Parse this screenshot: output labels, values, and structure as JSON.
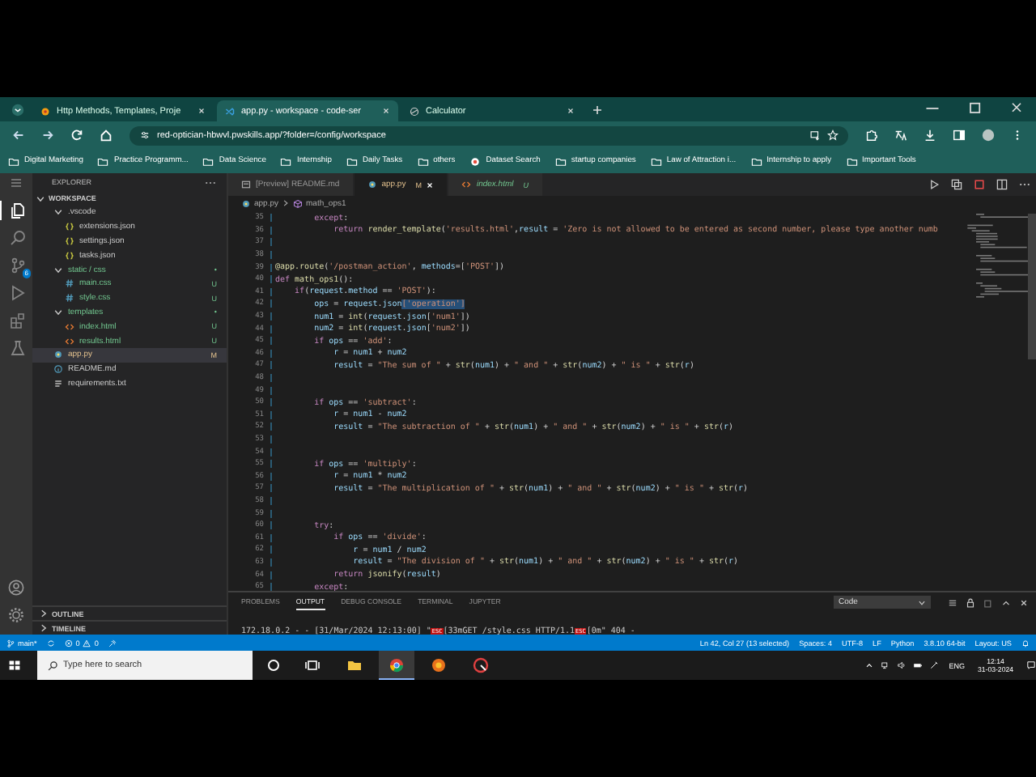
{
  "browser": {
    "tabs": [
      {
        "title": "Http Methods, Templates, Proje",
        "kind": "site",
        "selected": false
      },
      {
        "title": "app.py - workspace - code-ser",
        "kind": "code",
        "selected": true
      },
      {
        "title": "Calculator",
        "kind": "globe",
        "selected": false
      }
    ],
    "url": "red-optician-hbwvl.pwskills.app/?folder=/config/workspace",
    "bookmarks": [
      {
        "label": "Digital Marketing",
        "kind": "folder"
      },
      {
        "label": "Practice Programm...",
        "kind": "folder"
      },
      {
        "label": "Data Science",
        "kind": "folder"
      },
      {
        "label": "Internship",
        "kind": "folder"
      },
      {
        "label": "Daily Tasks",
        "kind": "folder"
      },
      {
        "label": "others",
        "kind": "folder"
      },
      {
        "label": "Dataset Search",
        "kind": "site"
      },
      {
        "label": "startup companies",
        "kind": "folder"
      },
      {
        "label": "Law of Attraction i...",
        "kind": "folder"
      },
      {
        "label": "Internship to apply",
        "kind": "folder"
      },
      {
        "label": "Important Tools",
        "kind": "folder"
      }
    ]
  },
  "activity_bar": {
    "items": [
      {
        "kind": "files",
        "selected": true
      },
      {
        "kind": "search",
        "selected": false
      },
      {
        "kind": "source-control",
        "selected": false,
        "badge": "6"
      },
      {
        "kind": "run",
        "selected": false
      },
      {
        "kind": "extensions",
        "selected": false
      },
      {
        "kind": "testing",
        "selected": false
      }
    ]
  },
  "sidebar": {
    "title": "EXPLORER",
    "section": "WORKSPACE",
    "items": [
      {
        "name": ".vscode",
        "kind": "folder",
        "expanded": true,
        "selected": false,
        "children": [
          {
            "name": "extensions.json",
            "kind": "json",
            "selected": false
          },
          {
            "name": "settings.json",
            "kind": "json",
            "selected": false
          },
          {
            "name": "tasks.json",
            "kind": "json",
            "selected": false
          }
        ]
      },
      {
        "name": "static / css",
        "kind": "folder",
        "expanded": true,
        "selected": false,
        "status": "•",
        "children": [
          {
            "name": "main.css",
            "kind": "css",
            "status": "U",
            "selected": false
          },
          {
            "name": "style.css",
            "kind": "css",
            "status": "U",
            "selected": false
          }
        ]
      },
      {
        "name": "templates",
        "kind": "folder",
        "expanded": true,
        "selected": false,
        "status": "•",
        "children": [
          {
            "name": "index.html",
            "kind": "html",
            "status": "U",
            "selected": false
          },
          {
            "name": "results.html",
            "kind": "html",
            "status": "U",
            "selected": false
          }
        ]
      },
      {
        "name": "app.py",
        "kind": "py",
        "status": "M",
        "selected": true
      },
      {
        "name": "README.md",
        "kind": "md",
        "selected": false
      },
      {
        "name": "requirements.txt",
        "kind": "txt",
        "selected": false
      }
    ],
    "bottom_sections": [
      "OUTLINE",
      "TIMELINE"
    ]
  },
  "editor": {
    "tabs": [
      {
        "label": "[Preview] README.md",
        "kind": "preview",
        "selected": false
      },
      {
        "label": "app.py",
        "kind": "py",
        "status": "M",
        "selected": true
      },
      {
        "label": "index.html",
        "kind": "html",
        "status": "U",
        "selected": false
      }
    ],
    "breadcrumb": [
      "app.py",
      "math_ops1"
    ],
    "lines": [
      {
        "number": "35",
        "tokens": [
          {
            "kind": "kw",
            "text": "        except"
          },
          {
            "kind": "plain",
            "text": ":"
          }
        ]
      },
      {
        "number": "36",
        "tokens": [
          {
            "kind": "kw",
            "text": "            return"
          },
          {
            "kind": "fn",
            "text": " render_template"
          },
          {
            "kind": "plain",
            "text": "("
          },
          {
            "kind": "str",
            "text": "'results.html'"
          },
          {
            "kind": "plain",
            "text": ","
          },
          {
            "kind": "var",
            "text": "result"
          },
          {
            "kind": "plain",
            "text": " = "
          },
          {
            "kind": "str",
            "text": "'Zero is not allowed to be entered as second number, please type another numb"
          }
        ]
      },
      {
        "number": "37"
      },
      {
        "number": "38"
      },
      {
        "number": "39",
        "tokens": [
          {
            "kind": "fn",
            "text": "@app.route"
          },
          {
            "kind": "plain",
            "text": "("
          },
          {
            "kind": "str",
            "text": "'/postman_action'"
          },
          {
            "kind": "plain",
            "text": ", "
          },
          {
            "kind": "var",
            "text": "methods"
          },
          {
            "kind": "plain",
            "text": "=["
          },
          {
            "kind": "str",
            "text": "'POST'"
          },
          {
            "kind": "plain",
            "text": "])"
          }
        ]
      },
      {
        "number": "40",
        "tokens": [
          {
            "kind": "kw",
            "text": "def"
          },
          {
            "kind": "fn",
            "text": " math_ops1"
          },
          {
            "kind": "plain",
            "text": "():"
          }
        ]
      },
      {
        "number": "41",
        "tokens": [
          {
            "kind": "kw",
            "text": "    if"
          },
          {
            "kind": "plain",
            "text": "("
          },
          {
            "kind": "var",
            "text": "request"
          },
          {
            "kind": "plain",
            "text": "."
          },
          {
            "kind": "var",
            "text": "method"
          },
          {
            "kind": "plain",
            "text": " == "
          },
          {
            "kind": "str",
            "text": "'POST'"
          },
          {
            "kind": "plain",
            "text": "):"
          }
        ]
      },
      {
        "number": "42",
        "tokens": [
          {
            "kind": "var",
            "text": "        ops"
          },
          {
            "kind": "plain",
            "text": " = "
          },
          {
            "kind": "var",
            "text": "request"
          },
          {
            "kind": "plain",
            "text": "."
          },
          {
            "kind": "var",
            "text": "json"
          },
          {
            "kind": "sel",
            "text": "['operation']"
          }
        ]
      },
      {
        "number": "43",
        "tokens": [
          {
            "kind": "var",
            "text": "        num1"
          },
          {
            "kind": "plain",
            "text": " = "
          },
          {
            "kind": "fn",
            "text": "int"
          },
          {
            "kind": "plain",
            "text": "("
          },
          {
            "kind": "var",
            "text": "request"
          },
          {
            "kind": "plain",
            "text": "."
          },
          {
            "kind": "var",
            "text": "json"
          },
          {
            "kind": "plain",
            "text": "["
          },
          {
            "kind": "str",
            "text": "'num1'"
          },
          {
            "kind": "plain",
            "text": "])"
          }
        ]
      },
      {
        "number": "44",
        "tokens": [
          {
            "kind": "var",
            "text": "        num2"
          },
          {
            "kind": "plain",
            "text": " = "
          },
          {
            "kind": "fn",
            "text": "int"
          },
          {
            "kind": "plain",
            "text": "("
          },
          {
            "kind": "var",
            "text": "request"
          },
          {
            "kind": "plain",
            "text": "."
          },
          {
            "kind": "var",
            "text": "json"
          },
          {
            "kind": "plain",
            "text": "["
          },
          {
            "kind": "str",
            "text": "'num2'"
          },
          {
            "kind": "plain",
            "text": "])"
          }
        ]
      },
      {
        "number": "45",
        "tokens": [
          {
            "kind": "kw",
            "text": "        if"
          },
          {
            "kind": "var",
            "text": " ops"
          },
          {
            "kind": "plain",
            "text": " == "
          },
          {
            "kind": "str",
            "text": "'add'"
          },
          {
            "kind": "plain",
            "text": ":"
          }
        ]
      },
      {
        "number": "46",
        "tokens": [
          {
            "kind": "var",
            "text": "            r"
          },
          {
            "kind": "plain",
            "text": " = "
          },
          {
            "kind": "var",
            "text": "num1"
          },
          {
            "kind": "plain",
            "text": " + "
          },
          {
            "kind": "var",
            "text": "num2"
          }
        ]
      },
      {
        "number": "47",
        "tokens": [
          {
            "kind": "var",
            "text": "            result"
          },
          {
            "kind": "plain",
            "text": " = "
          },
          {
            "kind": "str",
            "text": "\"The sum of \""
          },
          {
            "kind": "plain",
            "text": " + "
          },
          {
            "kind": "fn",
            "text": "str"
          },
          {
            "kind": "plain",
            "text": "("
          },
          {
            "kind": "var",
            "text": "num1"
          },
          {
            "kind": "plain",
            "text": ") + "
          },
          {
            "kind": "str",
            "text": "\" and \""
          },
          {
            "kind": "plain",
            "text": " + "
          },
          {
            "kind": "fn",
            "text": "str"
          },
          {
            "kind": "plain",
            "text": "("
          },
          {
            "kind": "var",
            "text": "num2"
          },
          {
            "kind": "plain",
            "text": ") + "
          },
          {
            "kind": "str",
            "text": "\" is \""
          },
          {
            "kind": "plain",
            "text": " + "
          },
          {
            "kind": "fn",
            "text": "str"
          },
          {
            "kind": "plain",
            "text": "("
          },
          {
            "kind": "var",
            "text": "r"
          },
          {
            "kind": "plain",
            "text": ")"
          }
        ]
      },
      {
        "number": "48"
      },
      {
        "number": "49"
      },
      {
        "number": "50",
        "tokens": [
          {
            "kind": "kw",
            "text": "        if"
          },
          {
            "kind": "var",
            "text": " ops"
          },
          {
            "kind": "plain",
            "text": " == "
          },
          {
            "kind": "str",
            "text": "'subtract'"
          },
          {
            "kind": "plain",
            "text": ":"
          }
        ]
      },
      {
        "number": "51",
        "tokens": [
          {
            "kind": "var",
            "text": "            r"
          },
          {
            "kind": "plain",
            "text": " = "
          },
          {
            "kind": "var",
            "text": "num1"
          },
          {
            "kind": "plain",
            "text": " - "
          },
          {
            "kind": "var",
            "text": "num2"
          }
        ]
      },
      {
        "number": "52",
        "tokens": [
          {
            "kind": "var",
            "text": "            result"
          },
          {
            "kind": "plain",
            "text": " = "
          },
          {
            "kind": "str",
            "text": "\"The subtraction of \""
          },
          {
            "kind": "plain",
            "text": " + "
          },
          {
            "kind": "fn",
            "text": "str"
          },
          {
            "kind": "plain",
            "text": "("
          },
          {
            "kind": "var",
            "text": "num1"
          },
          {
            "kind": "plain",
            "text": ") + "
          },
          {
            "kind": "str",
            "text": "\" and \""
          },
          {
            "kind": "plain",
            "text": " + "
          },
          {
            "kind": "fn",
            "text": "str"
          },
          {
            "kind": "plain",
            "text": "("
          },
          {
            "kind": "var",
            "text": "num2"
          },
          {
            "kind": "plain",
            "text": ") + "
          },
          {
            "kind": "str",
            "text": "\" is \""
          },
          {
            "kind": "plain",
            "text": " + "
          },
          {
            "kind": "fn",
            "text": "str"
          },
          {
            "kind": "plain",
            "text": "("
          },
          {
            "kind": "var",
            "text": "r"
          },
          {
            "kind": "plain",
            "text": ")"
          }
        ]
      },
      {
        "number": "53"
      },
      {
        "number": "54"
      },
      {
        "number": "55",
        "tokens": [
          {
            "kind": "kw",
            "text": "        if"
          },
          {
            "kind": "var",
            "text": " ops"
          },
          {
            "kind": "plain",
            "text": " == "
          },
          {
            "kind": "str",
            "text": "'multiply'"
          },
          {
            "kind": "plain",
            "text": ":"
          }
        ]
      },
      {
        "number": "56",
        "tokens": [
          {
            "kind": "var",
            "text": "            r"
          },
          {
            "kind": "plain",
            "text": " = "
          },
          {
            "kind": "var",
            "text": "num1"
          },
          {
            "kind": "plain",
            "text": " * "
          },
          {
            "kind": "var",
            "text": "num2"
          }
        ]
      },
      {
        "number": "57",
        "tokens": [
          {
            "kind": "var",
            "text": "            result"
          },
          {
            "kind": "plain",
            "text": " = "
          },
          {
            "kind": "str",
            "text": "\"The multiplication of \""
          },
          {
            "kind": "plain",
            "text": " + "
          },
          {
            "kind": "fn",
            "text": "str"
          },
          {
            "kind": "plain",
            "text": "("
          },
          {
            "kind": "var",
            "text": "num1"
          },
          {
            "kind": "plain",
            "text": ") + "
          },
          {
            "kind": "str",
            "text": "\" and \""
          },
          {
            "kind": "plain",
            "text": " + "
          },
          {
            "kind": "fn",
            "text": "str"
          },
          {
            "kind": "plain",
            "text": "("
          },
          {
            "kind": "var",
            "text": "num2"
          },
          {
            "kind": "plain",
            "text": ") + "
          },
          {
            "kind": "str",
            "text": "\" is \""
          },
          {
            "kind": "plain",
            "text": " + "
          },
          {
            "kind": "fn",
            "text": "str"
          },
          {
            "kind": "plain",
            "text": "("
          },
          {
            "kind": "var",
            "text": "r"
          },
          {
            "kind": "plain",
            "text": ")"
          }
        ]
      },
      {
        "number": "58"
      },
      {
        "number": "59"
      },
      {
        "number": "60",
        "tokens": [
          {
            "kind": "kw",
            "text": "        try"
          },
          {
            "kind": "plain",
            "text": ":"
          }
        ]
      },
      {
        "number": "61",
        "tokens": [
          {
            "kind": "kw",
            "text": "            if"
          },
          {
            "kind": "var",
            "text": " ops"
          },
          {
            "kind": "plain",
            "text": " == "
          },
          {
            "kind": "str",
            "text": "'divide'"
          },
          {
            "kind": "plain",
            "text": ":"
          }
        ]
      },
      {
        "number": "62",
        "tokens": [
          {
            "kind": "var",
            "text": "                r"
          },
          {
            "kind": "plain",
            "text": " = "
          },
          {
            "kind": "var",
            "text": "num1"
          },
          {
            "kind": "plain",
            "text": " / "
          },
          {
            "kind": "var",
            "text": "num2"
          }
        ]
      },
      {
        "number": "63",
        "tokens": [
          {
            "kind": "var",
            "text": "                result"
          },
          {
            "kind": "plain",
            "text": " = "
          },
          {
            "kind": "str",
            "text": "\"The division of \""
          },
          {
            "kind": "plain",
            "text": " + "
          },
          {
            "kind": "fn",
            "text": "str"
          },
          {
            "kind": "plain",
            "text": "("
          },
          {
            "kind": "var",
            "text": "num1"
          },
          {
            "kind": "plain",
            "text": ") + "
          },
          {
            "kind": "str",
            "text": "\" and \""
          },
          {
            "kind": "plain",
            "text": " + "
          },
          {
            "kind": "fn",
            "text": "str"
          },
          {
            "kind": "plain",
            "text": "("
          },
          {
            "kind": "var",
            "text": "num2"
          },
          {
            "kind": "plain",
            "text": ") + "
          },
          {
            "kind": "str",
            "text": "\" is \""
          },
          {
            "kind": "plain",
            "text": " + "
          },
          {
            "kind": "fn",
            "text": "str"
          },
          {
            "kind": "plain",
            "text": "("
          },
          {
            "kind": "var",
            "text": "r"
          },
          {
            "kind": "plain",
            "text": ")"
          }
        ]
      },
      {
        "number": "64",
        "tokens": [
          {
            "kind": "kw",
            "text": "            return"
          },
          {
            "kind": "fn",
            "text": " jsonify"
          },
          {
            "kind": "plain",
            "text": "("
          },
          {
            "kind": "var",
            "text": "result"
          },
          {
            "kind": "plain",
            "text": ")"
          }
        ]
      },
      {
        "number": "65",
        "tokens": [
          {
            "kind": "kw",
            "text": "        except"
          },
          {
            "kind": "plain",
            "text": ":"
          }
        ]
      }
    ]
  },
  "panel": {
    "tabs": [
      {
        "label": "PROBLEMS",
        "selected": false
      },
      {
        "label": "OUTPUT",
        "selected": true
      },
      {
        "label": "DEBUG CONSOLE",
        "selected": false
      },
      {
        "label": "TERMINAL",
        "selected": false
      },
      {
        "label": "JUPYTER",
        "selected": false
      }
    ],
    "channel": "Code",
    "output": [
      {
        "kind": "text",
        "text": "172.18.0.2 - - [31/Mar/2024 12:13:00] \""
      },
      {
        "kind": "control",
        "text": "ESC"
      },
      {
        "kind": "text",
        "text": "[33mGET /style.css HTTP/1.1"
      },
      {
        "kind": "control",
        "text": "ESC"
      },
      {
        "kind": "text",
        "text": "[0m\" 404 -"
      }
    ]
  },
  "status_bar": {
    "branch": "main*",
    "errors": "0",
    "warnings": "0",
    "right": [
      "Ln 42, Col 27 (13 selected)",
      "Spaces: 4",
      "UTF-8",
      "LF",
      "Python",
      "3.8.10 64-bit",
      "Layout: US"
    ]
  },
  "taskbar": {
    "search_placeholder": "Type here to search",
    "apps": [
      {
        "kind": "task-view",
        "selected": false
      },
      {
        "kind": "folder",
        "selected": false
      },
      {
        "kind": "chrome",
        "selected": true
      },
      {
        "kind": "orange",
        "selected": false
      },
      {
        "kind": "red",
        "selected": false
      }
    ],
    "language": "ENG",
    "time": "12:14",
    "date": "31-03-2024"
  }
}
